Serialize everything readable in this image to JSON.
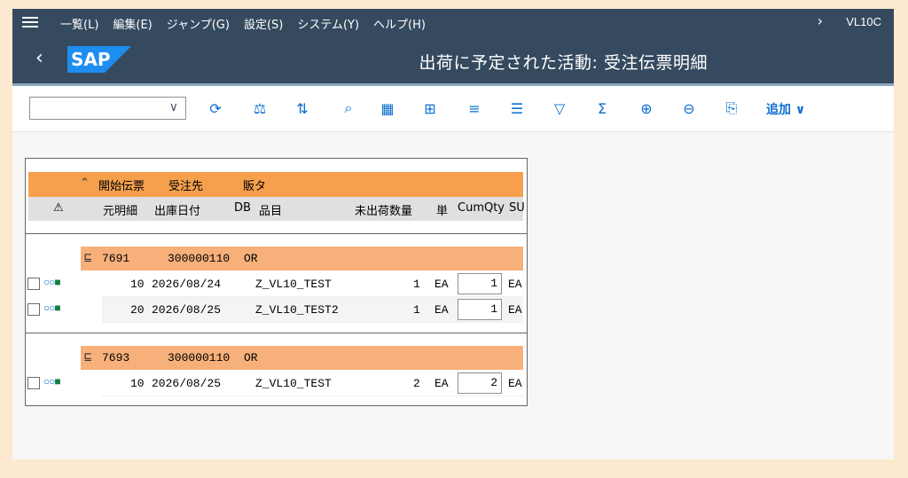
{
  "menubar": {
    "items": [
      "一覧(L)",
      "編集(E)",
      "ジャンプ(G)",
      "設定(S)",
      "システム(Y)",
      "ヘルプ(H)"
    ],
    "tcode": "VL10C"
  },
  "titlebar": {
    "logo": "SAP",
    "title": "出荷に予定された活動: 受注伝票明細"
  },
  "toolbar": {
    "dropdown_value": "",
    "icons": [
      "refresh-icon",
      "balance-icon",
      "sort-icon",
      "zoom-icon",
      "layout-icon",
      "grid-icon",
      "align-icon",
      "filter-lines-icon",
      "filter-icon",
      "sum-icon",
      "add-row-icon",
      "delete-row-icon",
      "export-icon"
    ],
    "more_label": "追加"
  },
  "table": {
    "header1": [
      "開始伝票",
      "受注先",
      "販タ"
    ],
    "header2": [
      "元明細",
      "出庫日付",
      "DB",
      "品目",
      "未出荷数量",
      "単",
      "CumQty",
      "SU"
    ],
    "groups": [
      {
        "doc": "7691",
        "customer": "300000110",
        "type": "OR",
        "rows": [
          {
            "item": "10",
            "date": "2026/08/24",
            "material": "Z_VL10_TEST",
            "open_qty": "1",
            "unit": "EA",
            "cum_qty": "1",
            "su": "EA"
          },
          {
            "item": "20",
            "date": "2026/08/25",
            "material": "Z_VL10_TEST2",
            "open_qty": "1",
            "unit": "EA",
            "cum_qty": "1",
            "su": "EA"
          }
        ]
      },
      {
        "doc": "7693",
        "customer": "300000110",
        "type": "OR",
        "rows": [
          {
            "item": "10",
            "date": "2026/08/25",
            "material": "Z_VL10_TEST",
            "open_qty": "2",
            "unit": "EA",
            "cum_qty": "2",
            "su": "EA"
          }
        ]
      }
    ]
  },
  "colors": {
    "shell": "#354a5f",
    "header_orange": "#f6a04d",
    "group_orange": "#f7b07a",
    "accent": "#0a6ed1"
  }
}
